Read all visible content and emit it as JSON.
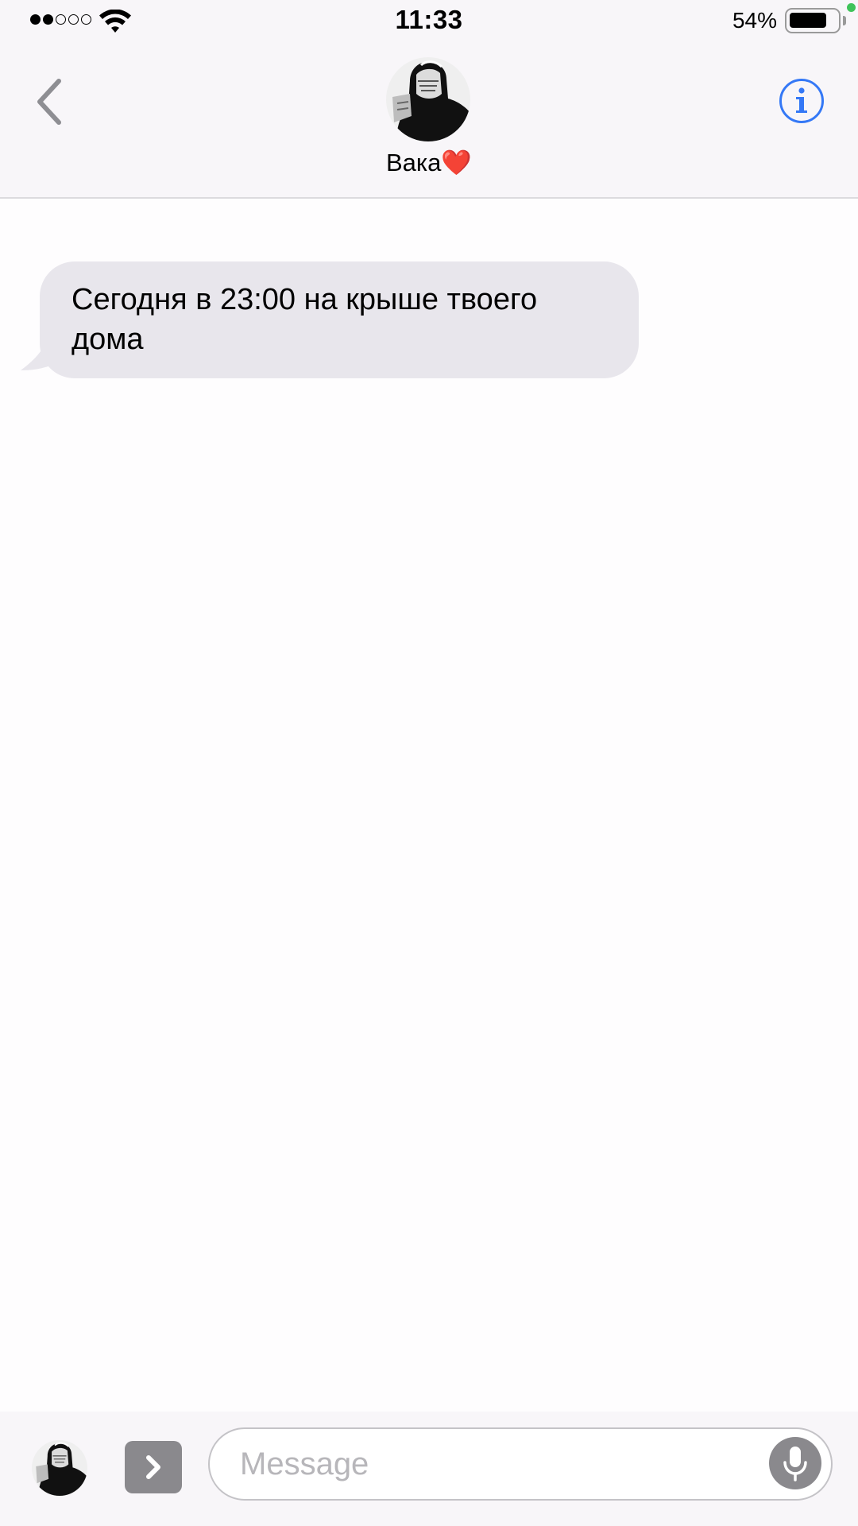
{
  "status_bar": {
    "signal_dots": [
      "full",
      "full",
      "empty",
      "empty",
      "empty"
    ],
    "wifi_icon": "wifi-icon",
    "time": "11:33",
    "battery_percent": "54%",
    "battery_level": 0.8,
    "battery_icon": "battery-icon",
    "privacy_indicator_color": "#3fc35a"
  },
  "header": {
    "back_icon": "chevron-left-icon",
    "contact_name": "Вака❤️",
    "avatar_icon": "contact-avatar",
    "info_icon": "info-icon",
    "accent_color": "#3478f6"
  },
  "conversation": {
    "messages": [
      {
        "direction": "incoming",
        "text": "Сегодня в 23:00 на крыше твоего дома"
      }
    ],
    "incoming_bubble_color": "#e8e6ec"
  },
  "input_bar": {
    "app_icon": "contact-avatar",
    "expand_icon": "chevron-right-icon",
    "placeholder": "Message",
    "mic_icon": "microphone-icon"
  }
}
